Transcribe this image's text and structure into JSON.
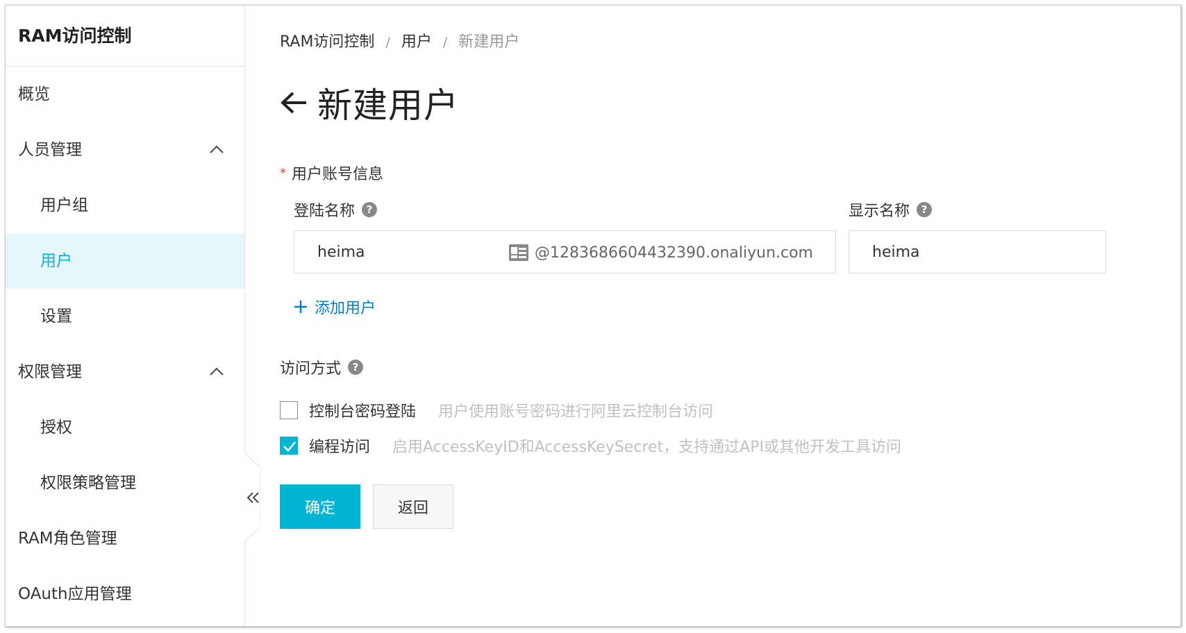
{
  "sidebar": {
    "title": "RAM访问控制",
    "items": [
      {
        "label": "概览"
      },
      {
        "label": "人员管理"
      },
      {
        "label": "用户组"
      },
      {
        "label": "用户"
      },
      {
        "label": "设置"
      },
      {
        "label": "权限管理"
      },
      {
        "label": "授权"
      },
      {
        "label": "权限策略管理"
      },
      {
        "label": "RAM角色管理"
      },
      {
        "label": "OAuth应用管理"
      }
    ],
    "active_item": "用户"
  },
  "breadcrumb": {
    "items": [
      "RAM访问控制",
      "用户",
      "新建用户"
    ],
    "separator": "/"
  },
  "page": {
    "title": "新建用户"
  },
  "form": {
    "account_section": "用户账号信息",
    "login_name_label": "登陆名称",
    "login_name_value": "heima",
    "login_name_suffix": "@1283686604432390.onaliyun.com",
    "display_name_label": "显示名称",
    "display_name_value": "heima",
    "add_user_label": "添加用户",
    "access_label": "访问方式",
    "access_options": [
      {
        "label": "控制台密码登陆",
        "description": "用户使用账号密码进行阿里云控制台访问",
        "checked": false
      },
      {
        "label": "编程访问",
        "description": "启用AccessKeyID和AccessKeySecret，支持通过API或其他开发工具访问",
        "checked": true
      }
    ],
    "help_glyph": "?"
  },
  "buttons": {
    "confirm": "确定",
    "back": "返回"
  },
  "colors": {
    "accent": "#00b5d4",
    "active_bg": "#e5f7fb",
    "link": "#0a7cc2",
    "required": "#e0453a"
  }
}
